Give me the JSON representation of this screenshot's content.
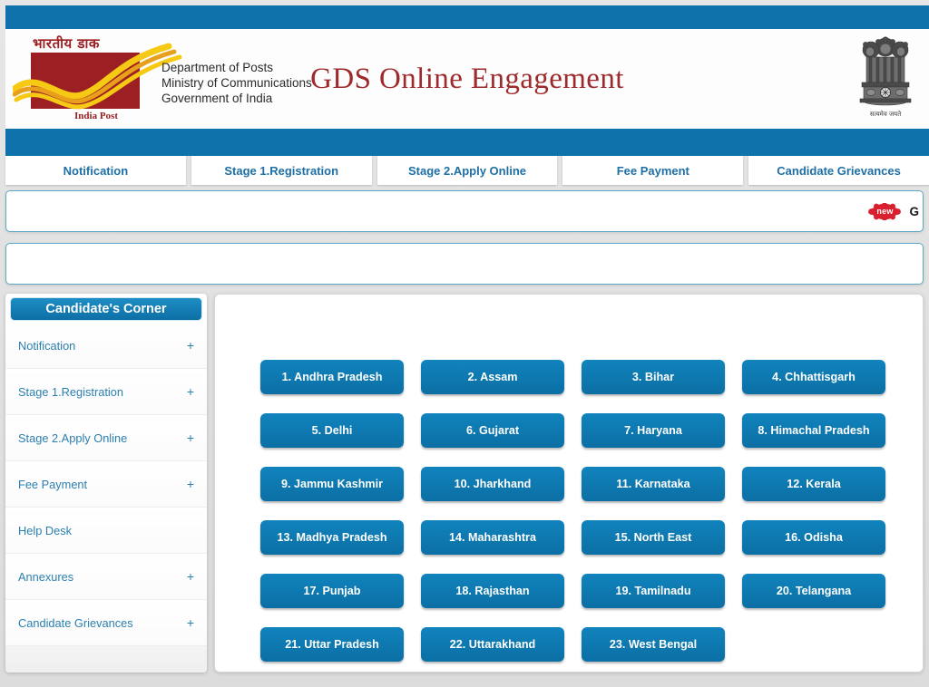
{
  "header": {
    "site_title": "GDS Online Engagement",
    "logo_hindi": "भारतीय डाक",
    "logo_caption": "India Post",
    "department_line1": "Department of Posts",
    "department_line2": "Ministry of Communications",
    "department_line3": "Government of India",
    "emblem_caption": "सत्यमेव जयते"
  },
  "nav": {
    "tabs": [
      {
        "label": "Notification"
      },
      {
        "label": "Stage 1.Registration"
      },
      {
        "label": "Stage 2.Apply Online"
      },
      {
        "label": "Fee Payment"
      },
      {
        "label": "Candidate Grievances"
      }
    ]
  },
  "marquee": {
    "badge_label": "new",
    "text": "G"
  },
  "sidebar": {
    "header_label": "Candidate's Corner",
    "items": [
      {
        "label": "Notification",
        "expand": "+"
      },
      {
        "label": "Stage 1.Registration",
        "expand": "+"
      },
      {
        "label": "Stage 2.Apply Online",
        "expand": "+"
      },
      {
        "label": "Fee Payment",
        "expand": "+"
      },
      {
        "label": "Help Desk",
        "expand": ""
      },
      {
        "label": "Annexures",
        "expand": "+"
      },
      {
        "label": "Candidate Grievances",
        "expand": "+"
      }
    ]
  },
  "states": [
    {
      "label": "1. Andhra Pradesh"
    },
    {
      "label": "2. Assam"
    },
    {
      "label": "3. Bihar"
    },
    {
      "label": "4. Chhattisgarh"
    },
    {
      "label": "5. Delhi"
    },
    {
      "label": "6. Gujarat"
    },
    {
      "label": "7. Haryana"
    },
    {
      "label": "8. Himachal Pradesh"
    },
    {
      "label": "9. Jammu Kashmir"
    },
    {
      "label": "10. Jharkhand"
    },
    {
      "label": "11. Karnataka"
    },
    {
      "label": "12. Kerala"
    },
    {
      "label": "13. Madhya Pradesh"
    },
    {
      "label": "14. Maharashtra"
    },
    {
      "label": "15. North East"
    },
    {
      "label": "16. Odisha"
    },
    {
      "label": "17. Punjab"
    },
    {
      "label": "18. Rajasthan"
    },
    {
      "label": "19. Tamilnadu"
    },
    {
      "label": "20. Telangana"
    },
    {
      "label": "21. Uttar Pradesh"
    },
    {
      "label": "22. Uttarakhand"
    },
    {
      "label": "23. West Bengal"
    }
  ],
  "colors": {
    "brand_blue": "#0f72ab",
    "title_red": "#9e2a2b",
    "logo_red": "#9c1f23",
    "logo_yellow": "#f5c518",
    "link_blue": "#2b7fae",
    "badge_red": "#d8202f",
    "page_bg": "#e3e3e3"
  }
}
